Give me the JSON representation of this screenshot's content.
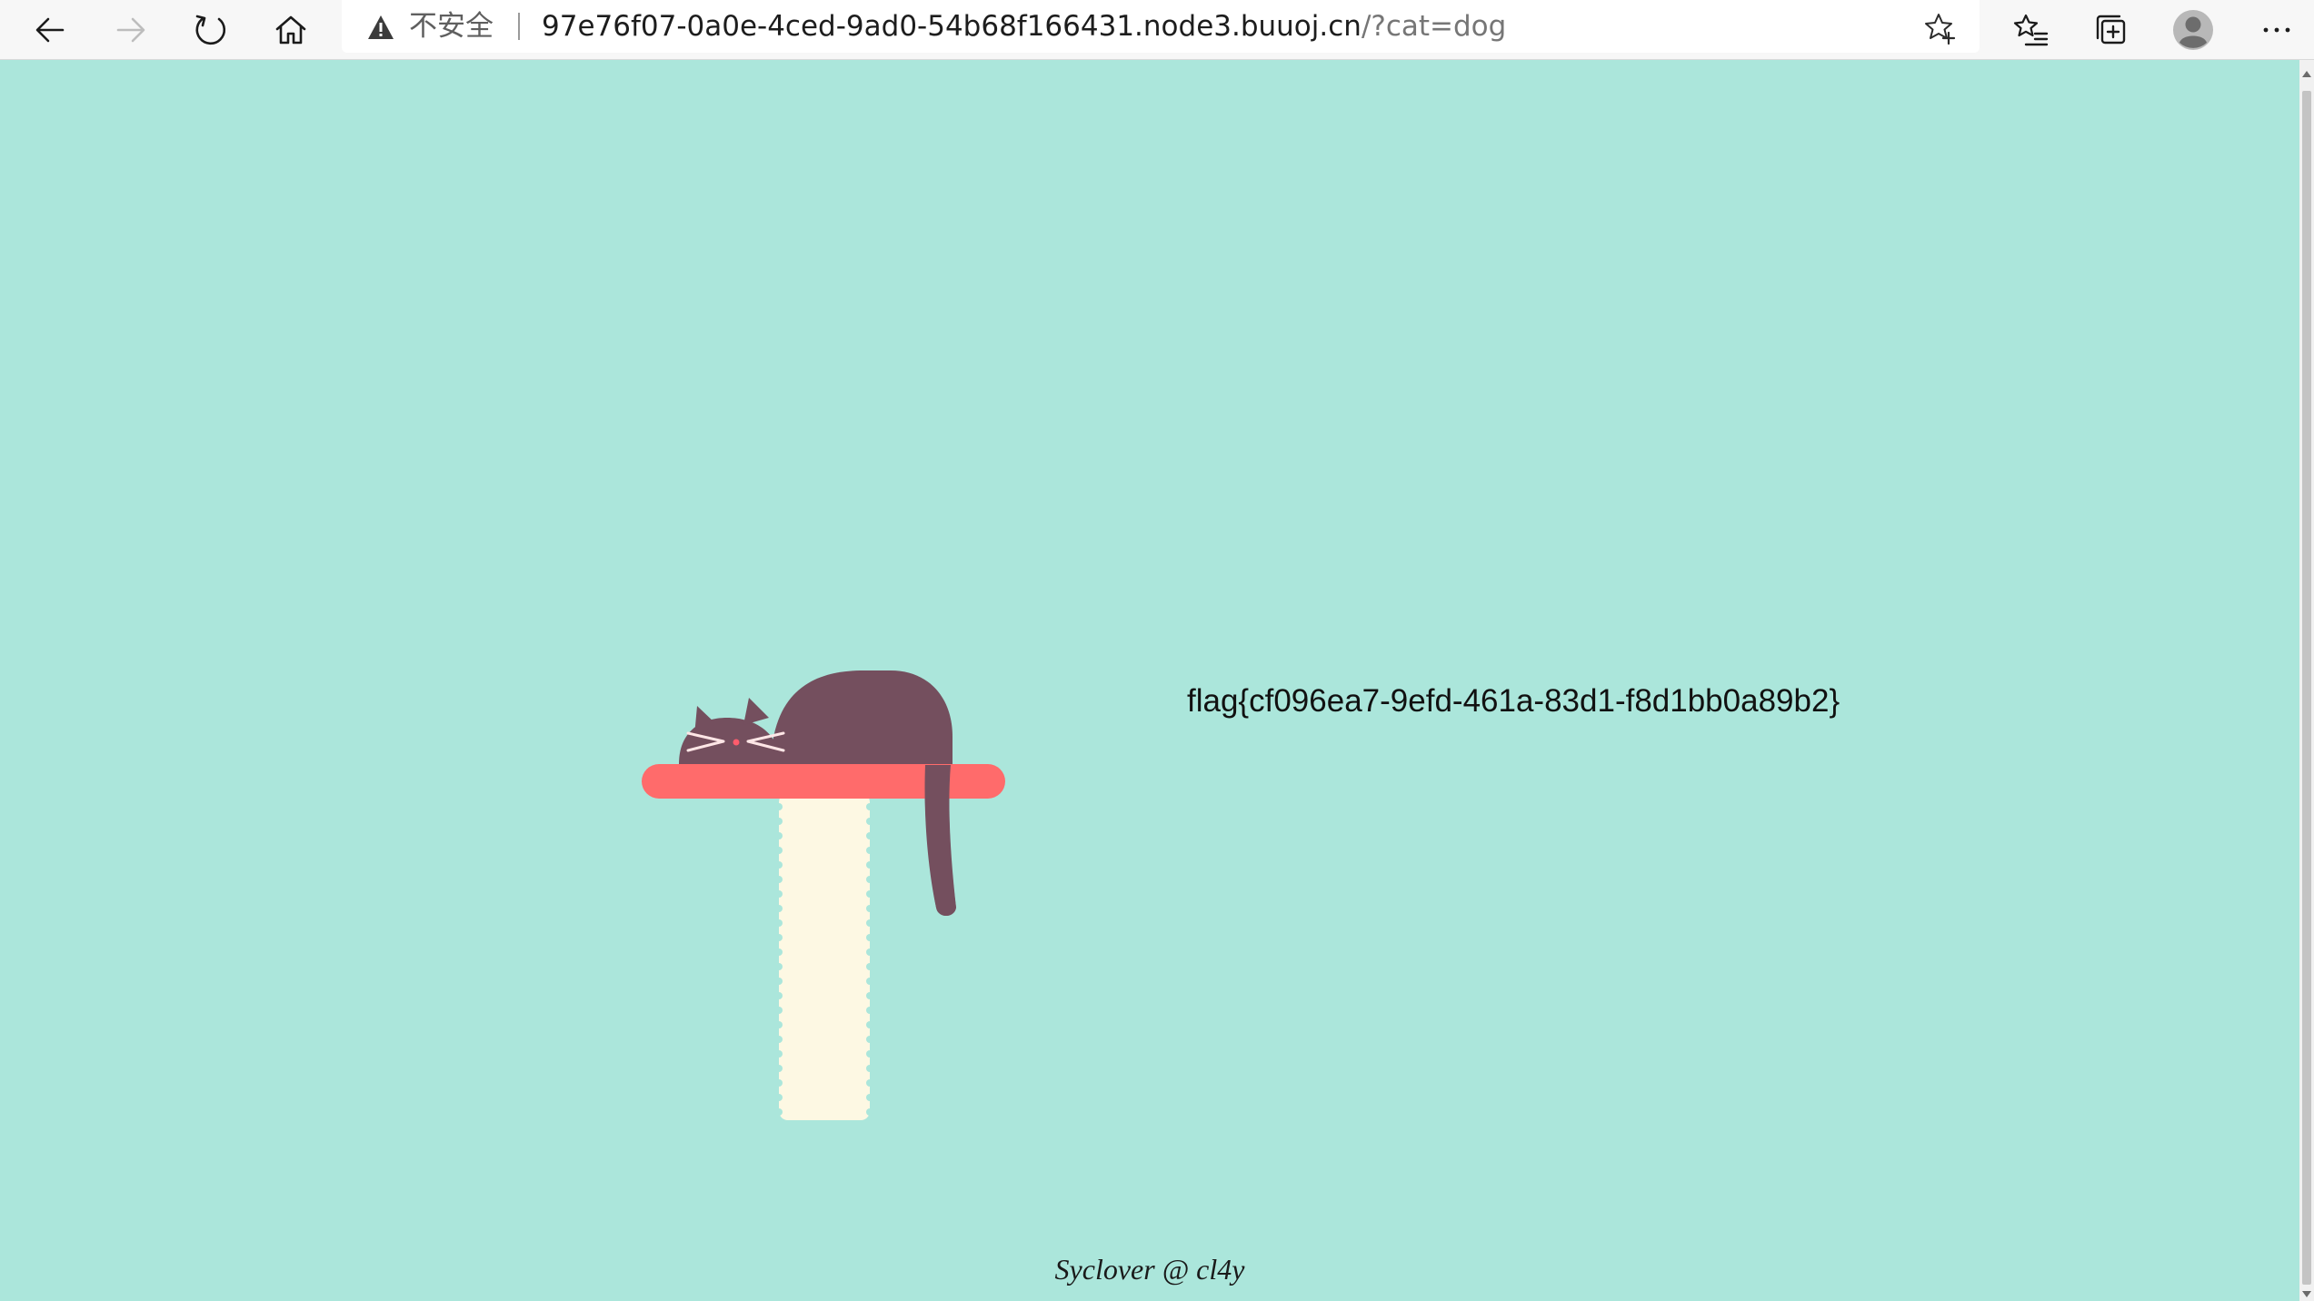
{
  "browser": {
    "address_bar": {
      "security_label": "不安全",
      "url_host": "97e76f07-0a0e-4ced-9ad0-54b68f166431.node3.buuoj.cn",
      "url_path": "/?cat=dog"
    },
    "icons": {
      "back": "back-arrow-icon",
      "forward": "forward-arrow-icon",
      "refresh": "refresh-icon",
      "home": "home-icon",
      "warning": "warning-triangle-icon",
      "favorite": "star-plus-icon",
      "favorites_list": "favorites-list-icon",
      "collections": "collections-icon",
      "profile": "profile-avatar-icon",
      "more": "more-dots-icon"
    },
    "forward_enabled": false
  },
  "page": {
    "flag": "flag{cf096ea7-9efd-461a-83d1-f8d1bb0a89b2}",
    "footer": "Syclover @ cl4y",
    "colors": {
      "background": "#abe6db",
      "cat": "#744f5e",
      "shelf": "#ff6b6b",
      "post": "#fdf8e3",
      "cat_face_marks": "#ffe6e6",
      "cat_nose": "#ff5c6c"
    }
  }
}
